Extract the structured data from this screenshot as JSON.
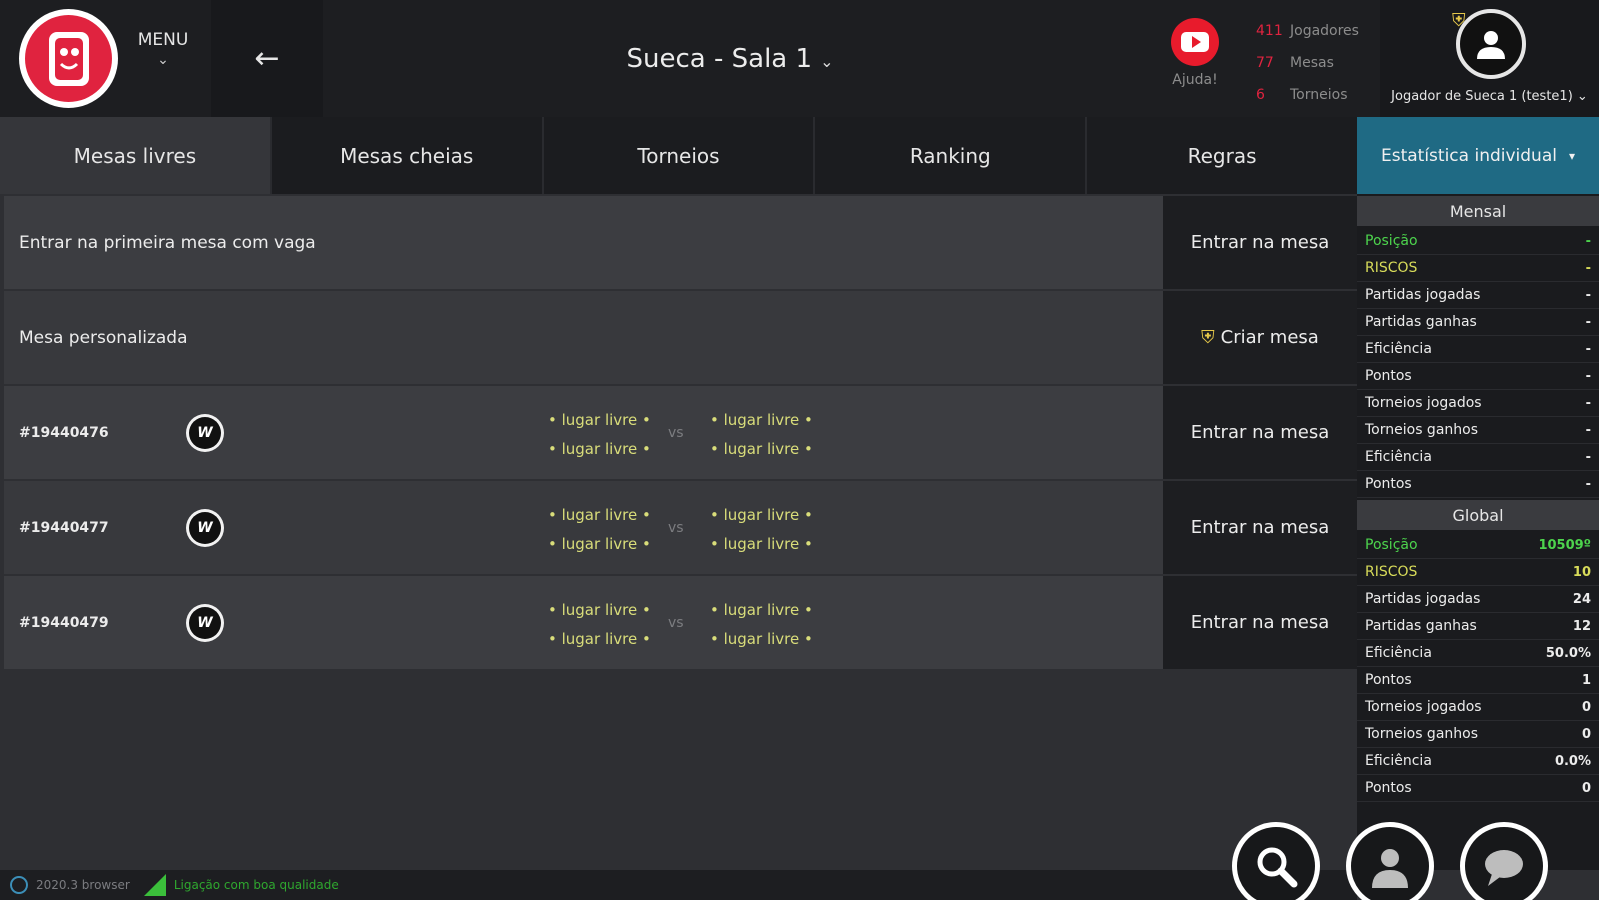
{
  "header": {
    "menu_label": "MENU",
    "room_title": "Sueca - Sala 1",
    "help_label": "Ajuda!",
    "stats": [
      {
        "num": "411",
        "label": "Jogadores"
      },
      {
        "num": "77",
        "label": "Mesas"
      },
      {
        "num": "6",
        "label": "Torneios"
      }
    ],
    "username": "Jogador de Sueca 1 (teste1)"
  },
  "tabs": [
    "Mesas livres",
    "Mesas cheias",
    "Torneios",
    "Ranking",
    "Regras"
  ],
  "stat_tab_label": "Estatística individual",
  "rows": {
    "first_table": {
      "text": "Entrar na primeira mesa com vaga",
      "button": "Entrar na mesa"
    },
    "custom_table": {
      "text": "Mesa personalizada",
      "button": "Criar mesa"
    },
    "tables": [
      {
        "id": "#19440476",
        "icon_text": "W",
        "seat_a1": "• lugar livre •",
        "seat_a2": "• lugar livre •",
        "vs": "vs",
        "seat_b1": "• lugar livre •",
        "seat_b2": "• lugar livre •",
        "button": "Entrar na mesa"
      },
      {
        "id": "#19440477",
        "icon_text": "W",
        "seat_a1": "• lugar livre •",
        "seat_a2": "• lugar livre •",
        "vs": "vs",
        "seat_b1": "• lugar livre •",
        "seat_b2": "• lugar livre •",
        "button": "Entrar na mesa"
      },
      {
        "id": "#19440479",
        "icon_text": "W",
        "seat_a1": "• lugar livre •",
        "seat_a2": "• lugar livre •",
        "vs": "vs",
        "seat_b1": "• lugar livre •",
        "seat_b2": "• lugar livre •",
        "button": "Entrar na mesa"
      }
    ]
  },
  "panel": {
    "monthly": {
      "title": "Mensal",
      "rows": [
        {
          "k": "Posição",
          "v": "-"
        },
        {
          "k": "RISCOS",
          "v": "-"
        },
        {
          "k": "Partidas jogadas",
          "v": "-"
        },
        {
          "k": "Partidas ganhas",
          "v": "-"
        },
        {
          "k": "Eficiência",
          "v": "-"
        },
        {
          "k": "Pontos",
          "v": "-"
        },
        {
          "k": "Torneios jogados",
          "v": "-"
        },
        {
          "k": "Torneios ganhos",
          "v": "-"
        },
        {
          "k": "Eficiência",
          "v": "-"
        },
        {
          "k": "Pontos",
          "v": "-"
        }
      ]
    },
    "global": {
      "title": "Global",
      "rows": [
        {
          "k": "Posição",
          "v": "10509º"
        },
        {
          "k": "RISCOS",
          "v": "10"
        },
        {
          "k": "Partidas jogadas",
          "v": "24"
        },
        {
          "k": "Partidas ganhas",
          "v": "12"
        },
        {
          "k": "Eficiência",
          "v": "50.0%"
        },
        {
          "k": "Pontos",
          "v": "1"
        },
        {
          "k": "Torneios jogados",
          "v": "0"
        },
        {
          "k": "Torneios ganhos",
          "v": "0"
        },
        {
          "k": "Eficiência",
          "v": "0.0%"
        },
        {
          "k": "Pontos",
          "v": "0"
        }
      ]
    }
  },
  "footer": {
    "version": "2020.3 browser",
    "connection": "Ligação com boa qualidade"
  },
  "colors": {
    "brand_red": "#e0233f",
    "accent_teal": "#1f6a84",
    "seat_yellow": "#d9dd7a",
    "position_green": "#4dd44d",
    "risk_yellow": "#d8dc5a"
  }
}
